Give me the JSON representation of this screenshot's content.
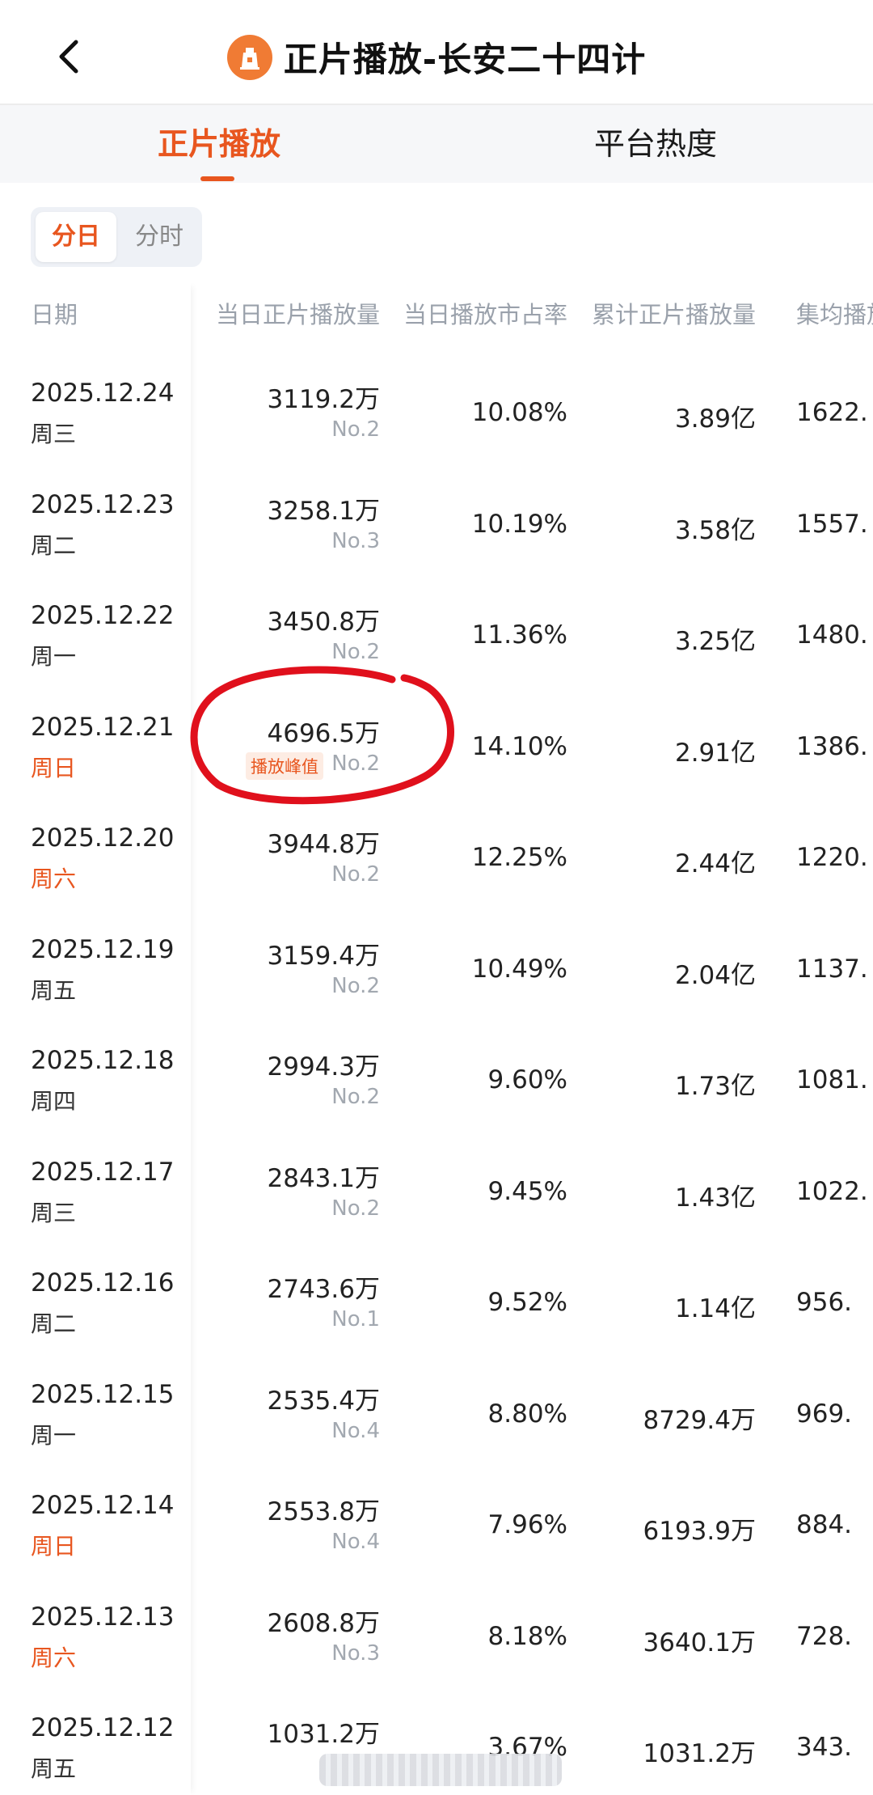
{
  "header": {
    "title": "正片播放-长安二十四计"
  },
  "tabs": [
    {
      "label": "正片播放",
      "active": true
    },
    {
      "label": "平台热度",
      "active": false
    }
  ],
  "toggle": {
    "day": "分日",
    "hour": "分时"
  },
  "table": {
    "headers": [
      "日期",
      "当日正片播放量",
      "当日播放市占率",
      "累计正片播放量",
      "集均播放"
    ],
    "rows": [
      {
        "date": "2025.12.24",
        "weekday": "周三",
        "daily": "3119.2万",
        "rank": "No.2",
        "share": "10.08%",
        "cumulative": "3.89亿",
        "avg": "1622.",
        "weekend": false,
        "peak": ""
      },
      {
        "date": "2025.12.23",
        "weekday": "周二",
        "daily": "3258.1万",
        "rank": "No.3",
        "share": "10.19%",
        "cumulative": "3.58亿",
        "avg": "1557.",
        "weekend": false,
        "peak": ""
      },
      {
        "date": "2025.12.22",
        "weekday": "周一",
        "daily": "3450.8万",
        "rank": "No.2",
        "share": "11.36%",
        "cumulative": "3.25亿",
        "avg": "1480.",
        "weekend": false,
        "peak": ""
      },
      {
        "date": "2025.12.21",
        "weekday": "周日",
        "daily": "4696.5万",
        "rank": "No.2",
        "share": "14.10%",
        "cumulative": "2.91亿",
        "avg": "1386.",
        "weekend": true,
        "peak": "播放峰值"
      },
      {
        "date": "2025.12.20",
        "weekday": "周六",
        "daily": "3944.8万",
        "rank": "No.2",
        "share": "12.25%",
        "cumulative": "2.44亿",
        "avg": "1220.",
        "weekend": true,
        "peak": ""
      },
      {
        "date": "2025.12.19",
        "weekday": "周五",
        "daily": "3159.4万",
        "rank": "No.2",
        "share": "10.49%",
        "cumulative": "2.04亿",
        "avg": "1137.",
        "weekend": false,
        "peak": ""
      },
      {
        "date": "2025.12.18",
        "weekday": "周四",
        "daily": "2994.3万",
        "rank": "No.2",
        "share": "9.60%",
        "cumulative": "1.73亿",
        "avg": "1081.",
        "weekend": false,
        "peak": ""
      },
      {
        "date": "2025.12.17",
        "weekday": "周三",
        "daily": "2843.1万",
        "rank": "No.2",
        "share": "9.45%",
        "cumulative": "1.43亿",
        "avg": "1022.",
        "weekend": false,
        "peak": ""
      },
      {
        "date": "2025.12.16",
        "weekday": "周二",
        "daily": "2743.6万",
        "rank": "No.1",
        "share": "9.52%",
        "cumulative": "1.14亿",
        "avg": "956.",
        "weekend": false,
        "peak": ""
      },
      {
        "date": "2025.12.15",
        "weekday": "周一",
        "daily": "2535.4万",
        "rank": "No.4",
        "share": "8.80%",
        "cumulative": "8729.4万",
        "avg": "969.",
        "weekend": false,
        "peak": ""
      },
      {
        "date": "2025.12.14",
        "weekday": "周日",
        "daily": "2553.8万",
        "rank": "No.4",
        "share": "7.96%",
        "cumulative": "6193.9万",
        "avg": "884.",
        "weekend": true,
        "peak": ""
      },
      {
        "date": "2025.12.13",
        "weekday": "周六",
        "daily": "2608.8万",
        "rank": "No.3",
        "share": "8.18%",
        "cumulative": "3640.1万",
        "avg": "728.",
        "weekend": true,
        "peak": ""
      },
      {
        "date": "2025.12.12",
        "weekday": "周五",
        "daily": "1031.2万",
        "rank": "",
        "share": "3.67%",
        "cumulative": "1031.2万",
        "avg": "343.",
        "weekend": false,
        "peak": ""
      }
    ]
  },
  "colors": {
    "accent": "#e8561f",
    "annotation": "#e0101c",
    "muted": "#9aa1ab"
  },
  "icons": {
    "back": "chevron-left-icon",
    "logo": "app-logo-icon"
  }
}
